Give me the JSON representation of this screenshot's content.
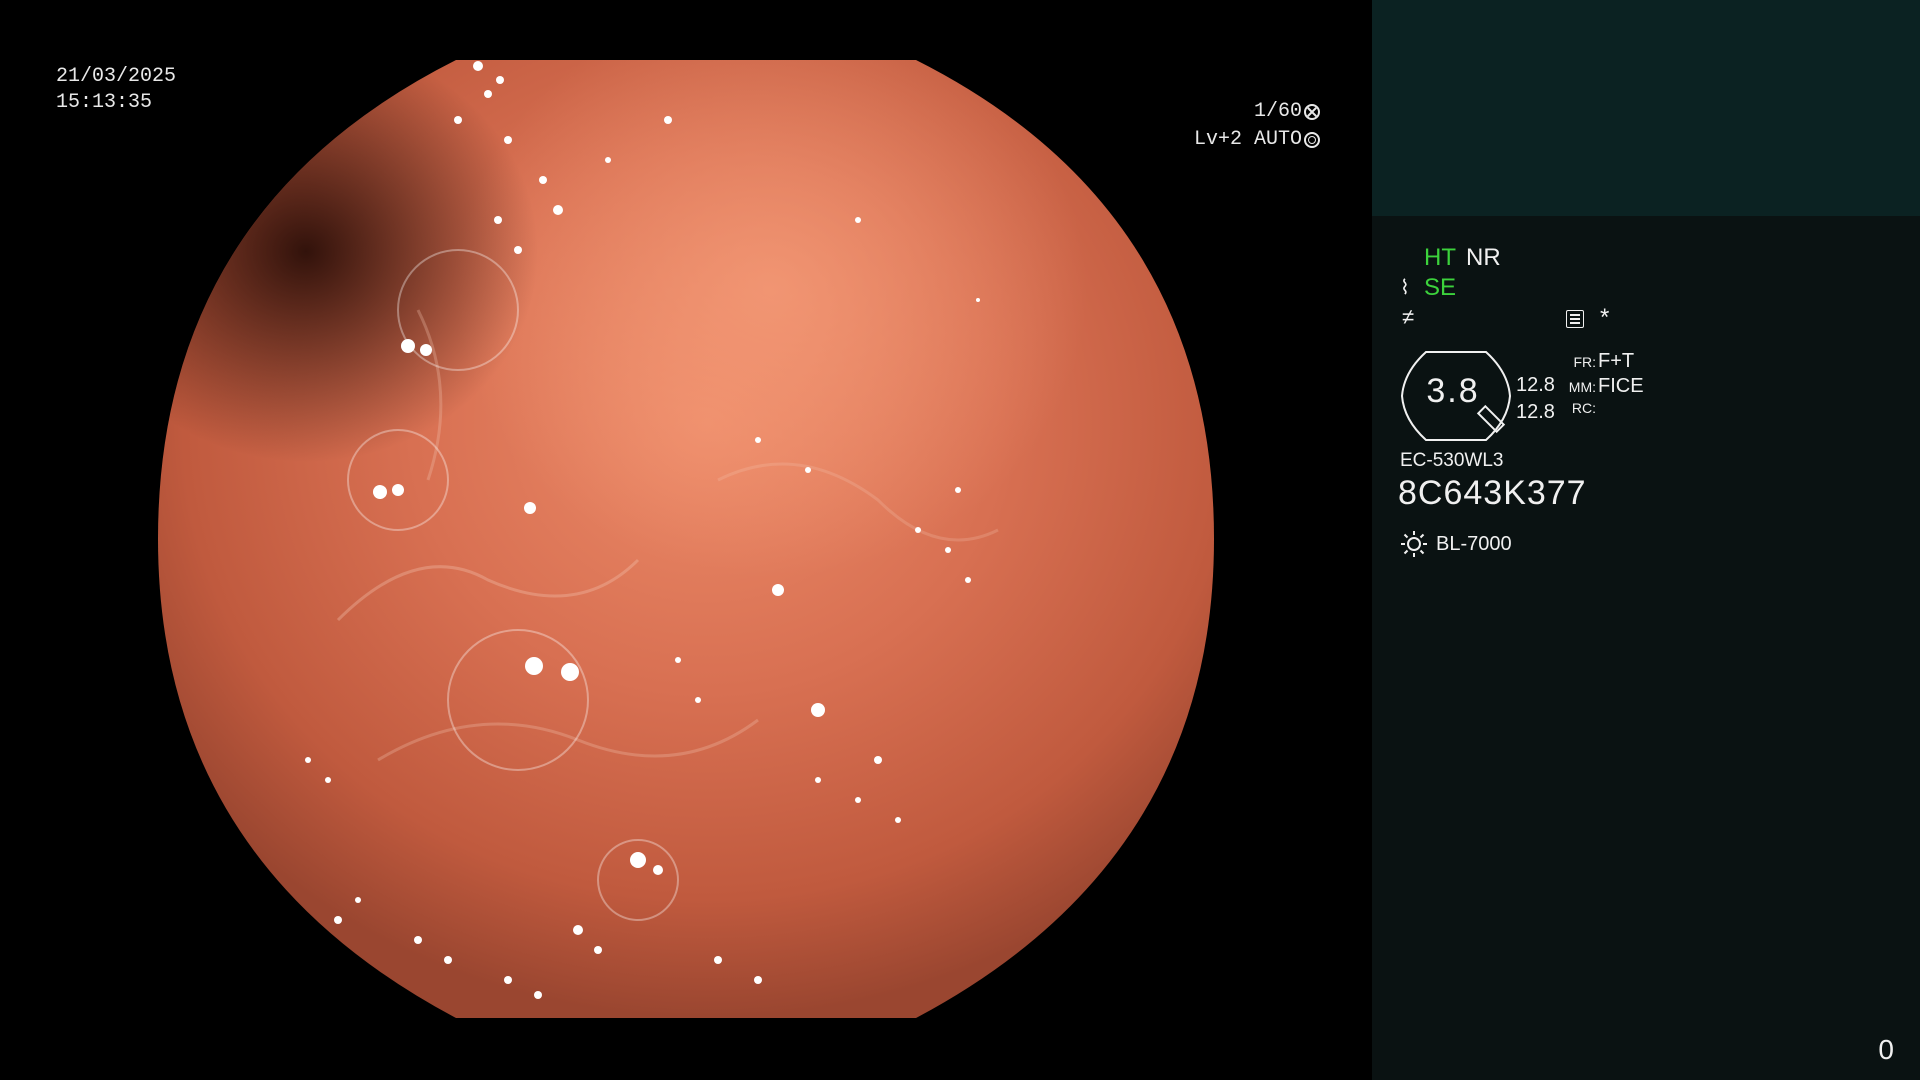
{
  "overlay": {
    "date": "21/03/2025",
    "time": "15:13:35",
    "shutter": "1/60",
    "shutter_icon": "shutter-icon",
    "iris_level": "Lv+2 AUTO",
    "iris_icon": "iris-icon"
  },
  "panel": {
    "mode_ht": "HT",
    "mode_nr": "NR",
    "mode_se": "SE",
    "wave_icon": "wave-icon",
    "not_equal_icon": "not-equal-icon",
    "list_icon": "list-icon",
    "star": "*",
    "zoom": "3.8",
    "scale_a": "12.8",
    "scale_b": "12.8",
    "settings": [
      {
        "key": "FR:",
        "value": "F+T"
      },
      {
        "key": "MM:",
        "value": "FICE"
      },
      {
        "key": "RC:",
        "value": ""
      }
    ],
    "scope_model": "EC-530WL3",
    "serial": "8C643K377",
    "light_icon": "sun-icon",
    "light_source": "BL-7000",
    "counter": "0"
  },
  "colors": {
    "panel_bg": "#0a1212",
    "thumb_bg": "#0b2222",
    "active_green": "#3cd23c",
    "mucosa": "#d06a4e"
  }
}
